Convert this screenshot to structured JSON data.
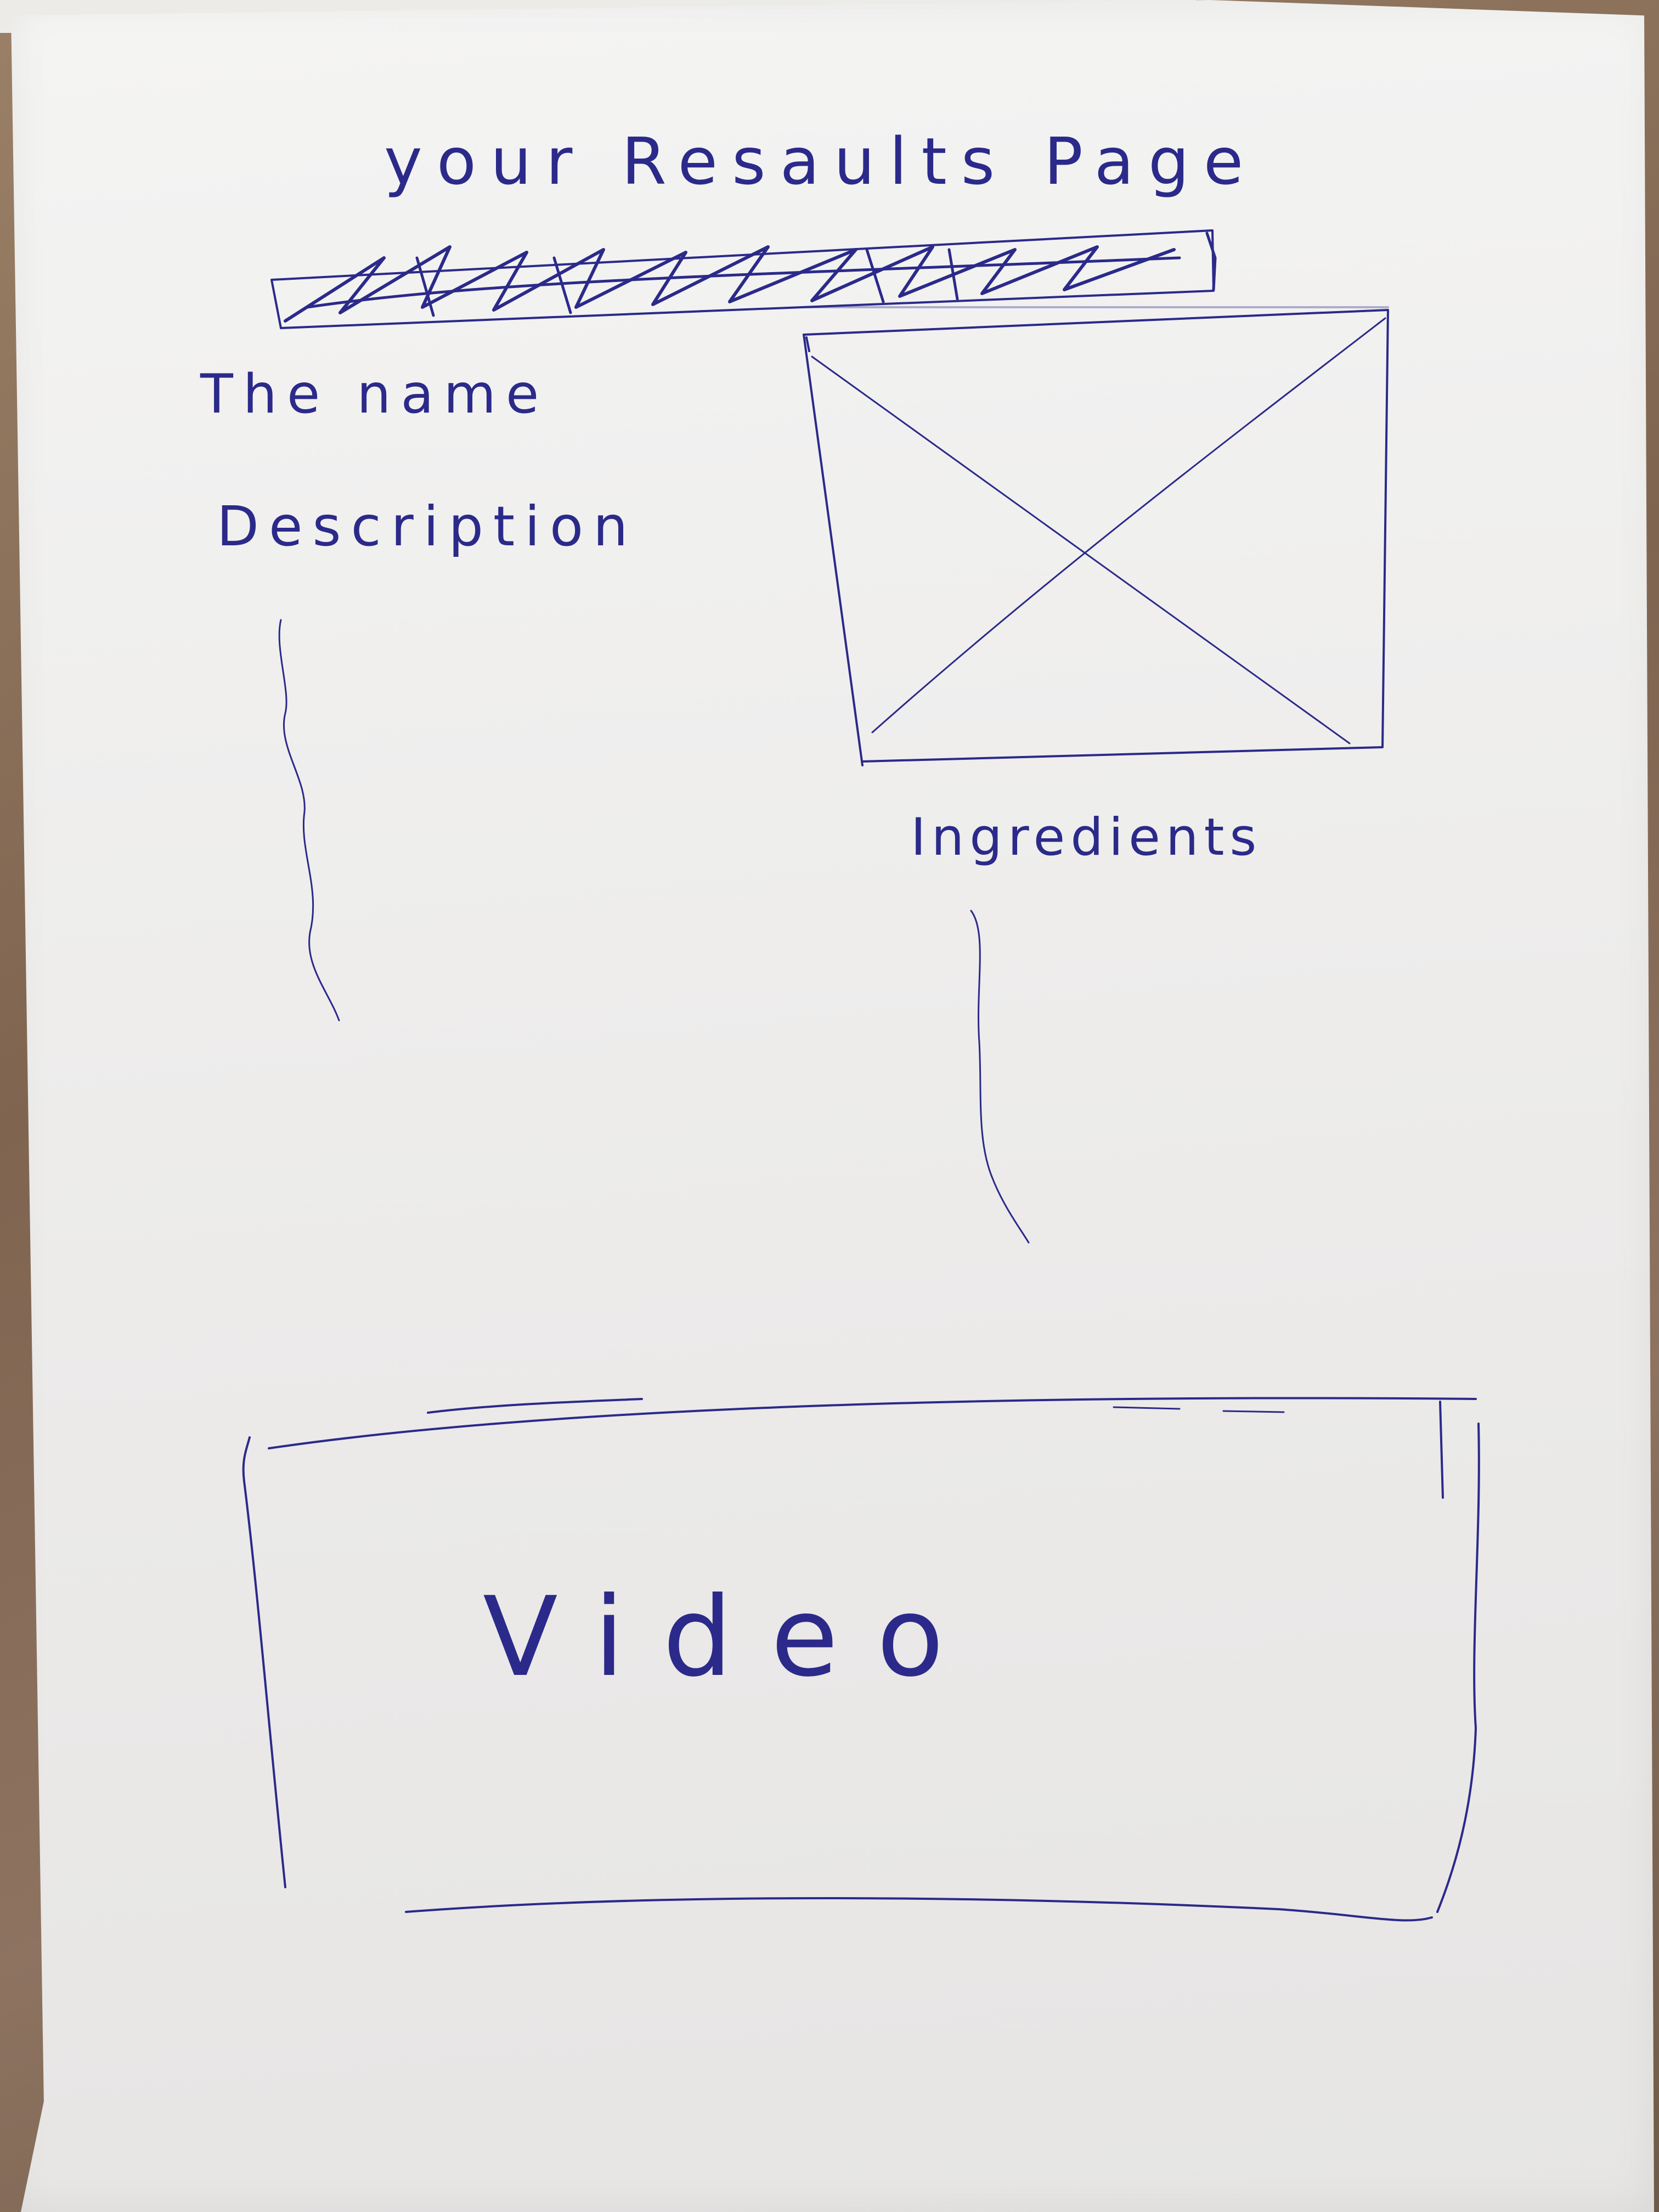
{
  "page": {
    "title": "your Resaults Page"
  },
  "content": {
    "name_label": "The name",
    "description_label": "Description",
    "ingredients_label": "Ingredients",
    "image_placeholder": "crossed-box-image-placeholder",
    "video_label": "Video"
  },
  "colors": {
    "ink": "#2b2a8a",
    "paper": "#efeeed",
    "table": "#8a6f55"
  }
}
